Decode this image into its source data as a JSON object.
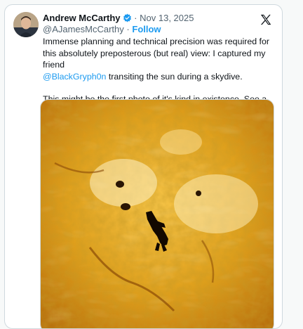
{
  "tweet": {
    "author_name": "Andrew McCarthy",
    "handle": "@AJamesMcCarthy",
    "separator": "·",
    "date": "Nov 13, 2025",
    "follow_label": "Follow",
    "text_line1": "Immense planning and technical precision was required for this absolutely preposterous (but real) view: I captured my friend",
    "mention": "@BlackGryph0n",
    "text_line1_end": " transiting the sun during a skydive.",
    "text_line2": "This might be the first photo of it's kind in existence. See a video of this moment in the reply",
    "icons": {
      "verified": "verified-badge-icon",
      "platform": "x-logo-icon",
      "emoji": "pointing-down-hand-emoji"
    },
    "colors": {
      "accent": "#1d9bf0",
      "text": "#0f1419",
      "muted": "#536471",
      "sun": "#e3a21a"
    }
  }
}
